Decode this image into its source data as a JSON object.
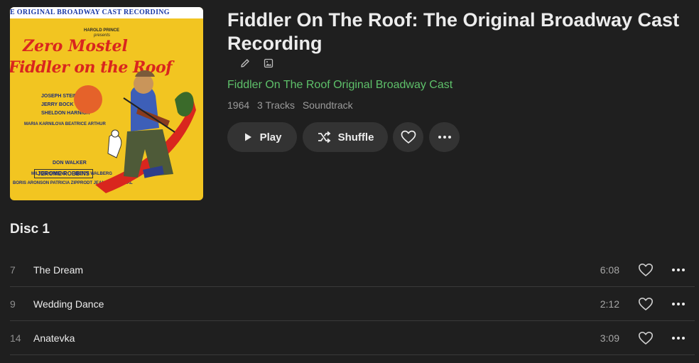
{
  "album": {
    "title": "Fiddler On The Roof: The Original Broadway Cast Recording",
    "artist": "Fiddler On The Roof Original Broadway Cast",
    "year": "1964",
    "track_count": "3 Tracks",
    "genre": "Soundtrack",
    "accent_color": "#5ec06a"
  },
  "cover": {
    "top_text": "E ORIGINAL BROADWAY CAST RECORDING",
    "presenter": "HAROLD PRINCE",
    "presents": "presents",
    "star": "Zero Mostel",
    "show_title": "Fiddler on the Roof",
    "credits": [
      "JOSEPH STEIN",
      "JERRY BOCK",
      "SHELDON HARNICK",
      "MARIA KARNILOVA  BEATRICE ARTHUR"
    ],
    "director": "JEROME ROBBINS",
    "orchestrations": "DON WALKER",
    "bottom_credits": [
      "MILTON GREENE",
      "BETTY WALBERG",
      "BORIS ARONSON  PATRICIA ZIPPRODT  JEAN ROSENTHAL"
    ]
  },
  "actions": {
    "play_label": "Play",
    "shuffle_label": "Shuffle",
    "edit_icon": "pencil-icon",
    "artwork_icon": "image-icon",
    "heart_icon": "heart-icon",
    "more_icon": "more-icon"
  },
  "disc": {
    "label": "Disc 1"
  },
  "tracks": [
    {
      "number": "7",
      "title": "The Dream",
      "duration": "6:08"
    },
    {
      "number": "9",
      "title": "Wedding Dance",
      "duration": "2:12"
    },
    {
      "number": "14",
      "title": "Anatevka",
      "duration": "3:09"
    }
  ]
}
